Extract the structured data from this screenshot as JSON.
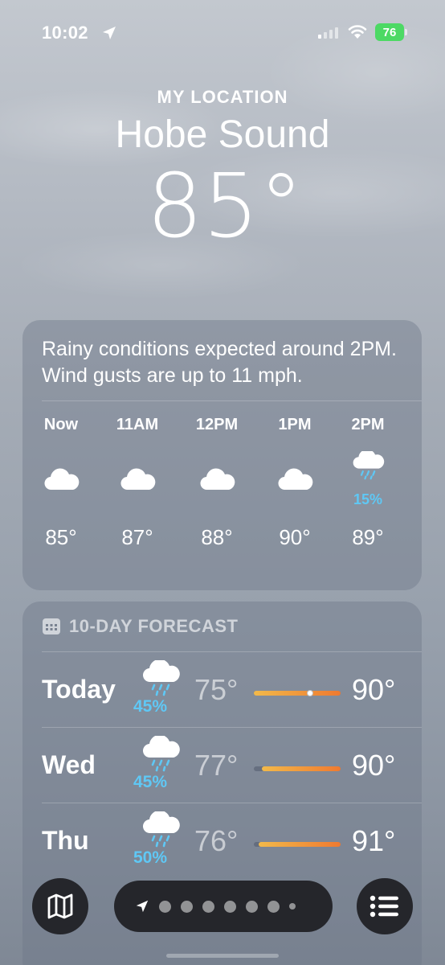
{
  "status_bar": {
    "time": "10:02",
    "battery": "76",
    "signal_bars_active": 1,
    "signal_bars_total": 4
  },
  "header": {
    "location_label": "MY LOCATION",
    "city": "Hobe Sound",
    "temperature": "85°"
  },
  "hourly": {
    "summary": "Rainy conditions expected around 2PM. Wind gusts are up to 11 mph.",
    "hours": [
      {
        "label": "Now",
        "icon": "cloud-icon",
        "pop": "",
        "temp": "85°"
      },
      {
        "label": "11AM",
        "icon": "cloud-icon",
        "pop": "",
        "temp": "87°"
      },
      {
        "label": "12PM",
        "icon": "cloud-icon",
        "pop": "",
        "temp": "88°"
      },
      {
        "label": "1PM",
        "icon": "cloud-icon",
        "pop": "",
        "temp": "90°"
      },
      {
        "label": "2PM",
        "icon": "cloud-rain-icon",
        "pop": "15%",
        "temp": "89°"
      }
    ]
  },
  "forecast": {
    "title": "10-DAY FORECAST",
    "days": [
      {
        "day": "Today",
        "icon": "cloud-rain-icon",
        "pop": "45%",
        "low": "75°",
        "high": "90°",
        "current_marker": true
      },
      {
        "day": "Wed",
        "icon": "cloud-rain-icon",
        "pop": "45%",
        "low": "77°",
        "high": "90°",
        "current_marker": false
      },
      {
        "day": "Thu",
        "icon": "cloud-rain-icon",
        "pop": "50%",
        "low": "76°",
        "high": "91°",
        "current_marker": false
      }
    ]
  },
  "toolbar": {
    "map_icon": "map-icon",
    "list_icon": "list-icon",
    "page_dots": 7
  },
  "colors": {
    "precip": "#5fc8f5",
    "bar_start": "#f2b94a",
    "bar_end": "#ef7a30",
    "battery": "#4cd964"
  }
}
